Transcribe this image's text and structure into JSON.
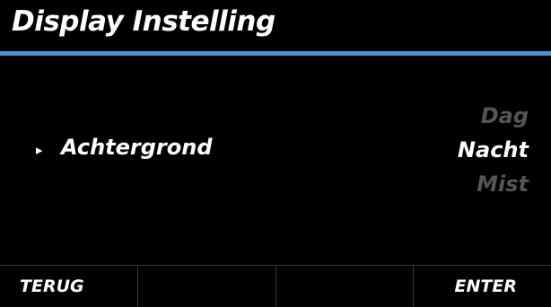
{
  "header": {
    "title": "Display Instelling",
    "accent_color": "#4a90d0"
  },
  "setting": {
    "label": "Achtergrond",
    "selected_option": "Nacht",
    "options": [
      "Dag",
      "Nacht",
      "Mist"
    ],
    "indicator_icon": "pointer-right-icon"
  },
  "softkeys": [
    {
      "label": "TERUG"
    },
    {
      "label": ""
    },
    {
      "label": ""
    },
    {
      "label": "ENTER"
    }
  ]
}
